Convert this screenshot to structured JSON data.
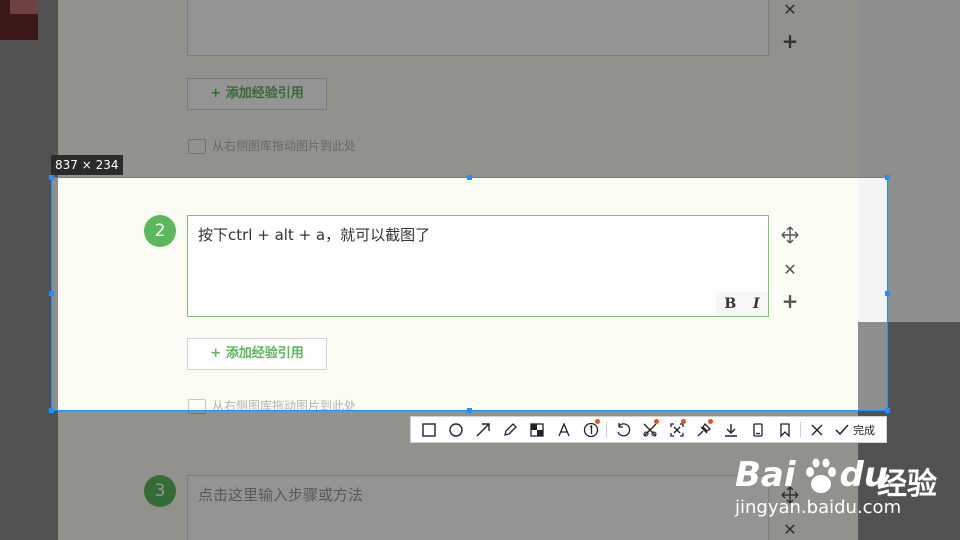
{
  "selection": {
    "size_label": "837 × 234"
  },
  "steps": [
    {
      "number": "",
      "text": "",
      "placeholder": ""
    },
    {
      "number": "2",
      "text": "按下ctrl + alt + a，就可以截图了",
      "format_bold": "B",
      "format_italic": "I"
    },
    {
      "number": "3",
      "placeholder": "点击这里输入步骤或方法"
    }
  ],
  "add_reference_label": "+ 添加经验引用",
  "drag_image_hint": "从右侧图库拖动图片到此处",
  "toolbar": {
    "tools": [
      {
        "icon": "rectangle-icon"
      },
      {
        "icon": "ellipse-icon"
      },
      {
        "icon": "arrow-icon"
      },
      {
        "icon": "pencil-icon"
      },
      {
        "icon": "mosaic-icon"
      },
      {
        "icon": "text-icon"
      },
      {
        "icon": "number-marker-icon"
      },
      {
        "icon": "undo-icon"
      },
      {
        "icon": "crop-icon"
      },
      {
        "icon": "expand-icon"
      },
      {
        "icon": "pin-icon"
      },
      {
        "icon": "save-icon"
      },
      {
        "icon": "phone-icon"
      },
      {
        "icon": "bookmark-icon"
      },
      {
        "icon": "close-icon"
      }
    ],
    "done_label": "完成"
  },
  "watermark": {
    "brand": "Bai",
    "brand2": "du",
    "cn": "经验",
    "url": "jingyan.baidu.com"
  },
  "colors": {
    "accent_green": "#5cb85c",
    "selection_blue": "#1e90ff",
    "badge_orange": "#e8521f"
  }
}
